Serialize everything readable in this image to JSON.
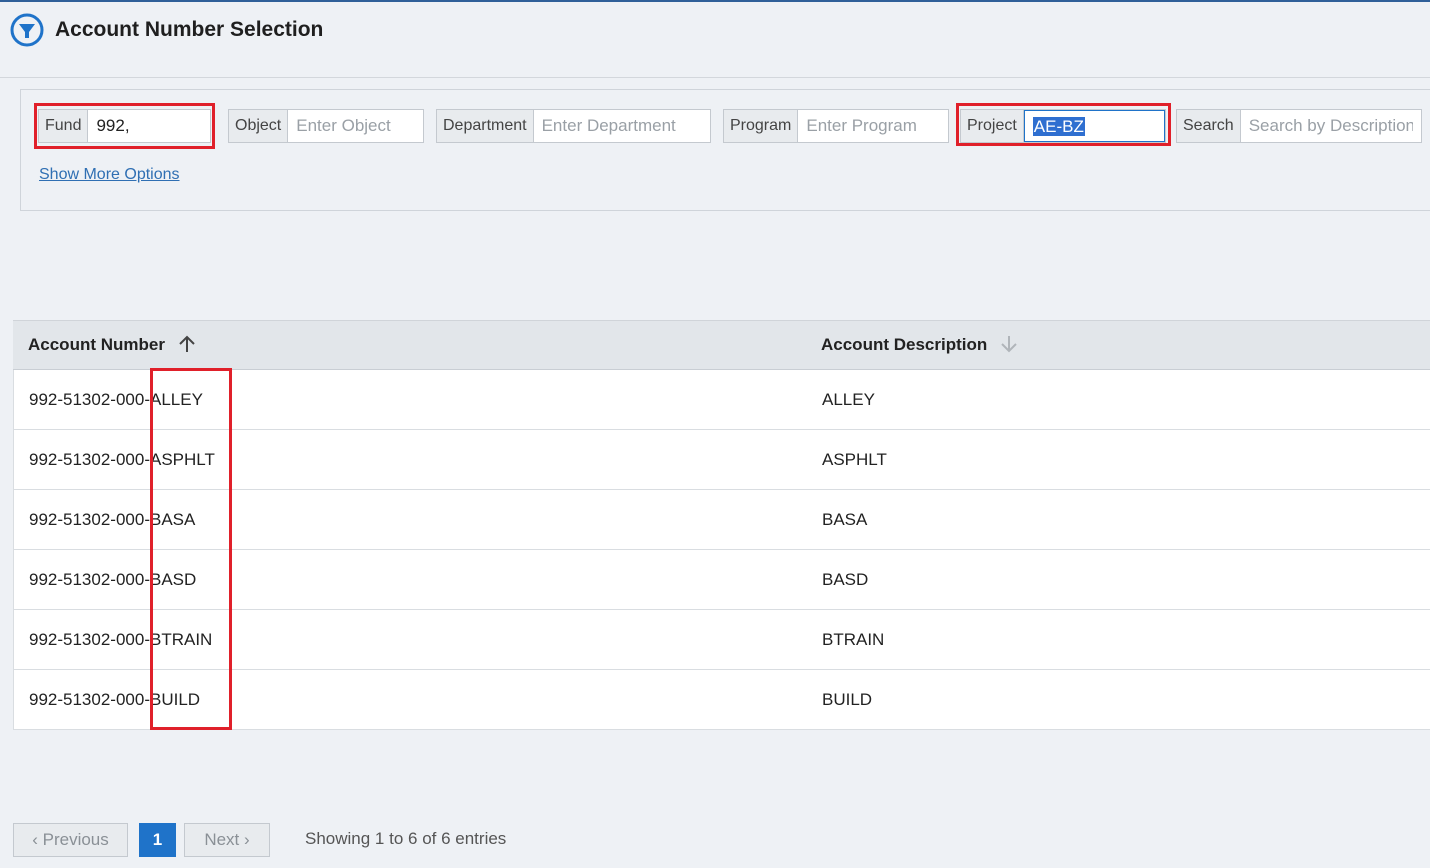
{
  "header": {
    "title": "Account Number Selection",
    "icon": "filter-circle-icon"
  },
  "filters": {
    "fund": {
      "label": "Fund",
      "value": "992,"
    },
    "object": {
      "label": "Object",
      "placeholder": "Enter Object"
    },
    "department": {
      "label": "Department",
      "placeholder": "Enter Department"
    },
    "program": {
      "label": "Program",
      "placeholder": "Enter Program"
    },
    "project": {
      "label": "Project",
      "value": "AE-BZ"
    },
    "search": {
      "label": "Search",
      "placeholder": "Search by Description"
    },
    "show_more": "Show More Options"
  },
  "table": {
    "columns": [
      "Account Number",
      "Account Description"
    ],
    "rows": [
      {
        "prefix": "992-51302-000",
        "sep": "-",
        "project": "ALLEY",
        "description": "ALLEY"
      },
      {
        "prefix": "992-51302-000",
        "sep": "-",
        "project": "ASPHLT",
        "description": "ASPHLT"
      },
      {
        "prefix": "992-51302-000",
        "sep": "-",
        "project": "BASA",
        "description": "BASA"
      },
      {
        "prefix": "992-51302-000",
        "sep": "-",
        "project": "BASD",
        "description": "BASD"
      },
      {
        "prefix": "992-51302-000",
        "sep": "-",
        "project": "BTRAIN",
        "description": "BTRAIN"
      },
      {
        "prefix": "992-51302-000",
        "sep": "-",
        "project": "BUILD",
        "description": "BUILD"
      }
    ]
  },
  "pagination": {
    "previous": "Previous",
    "page": "1",
    "next": "Next",
    "summary": "Showing 1 to 6 of 6 entries"
  },
  "colors": {
    "accent": "#1f73c9",
    "highlight": "#e0202a",
    "selection": "#2f6fd0"
  }
}
